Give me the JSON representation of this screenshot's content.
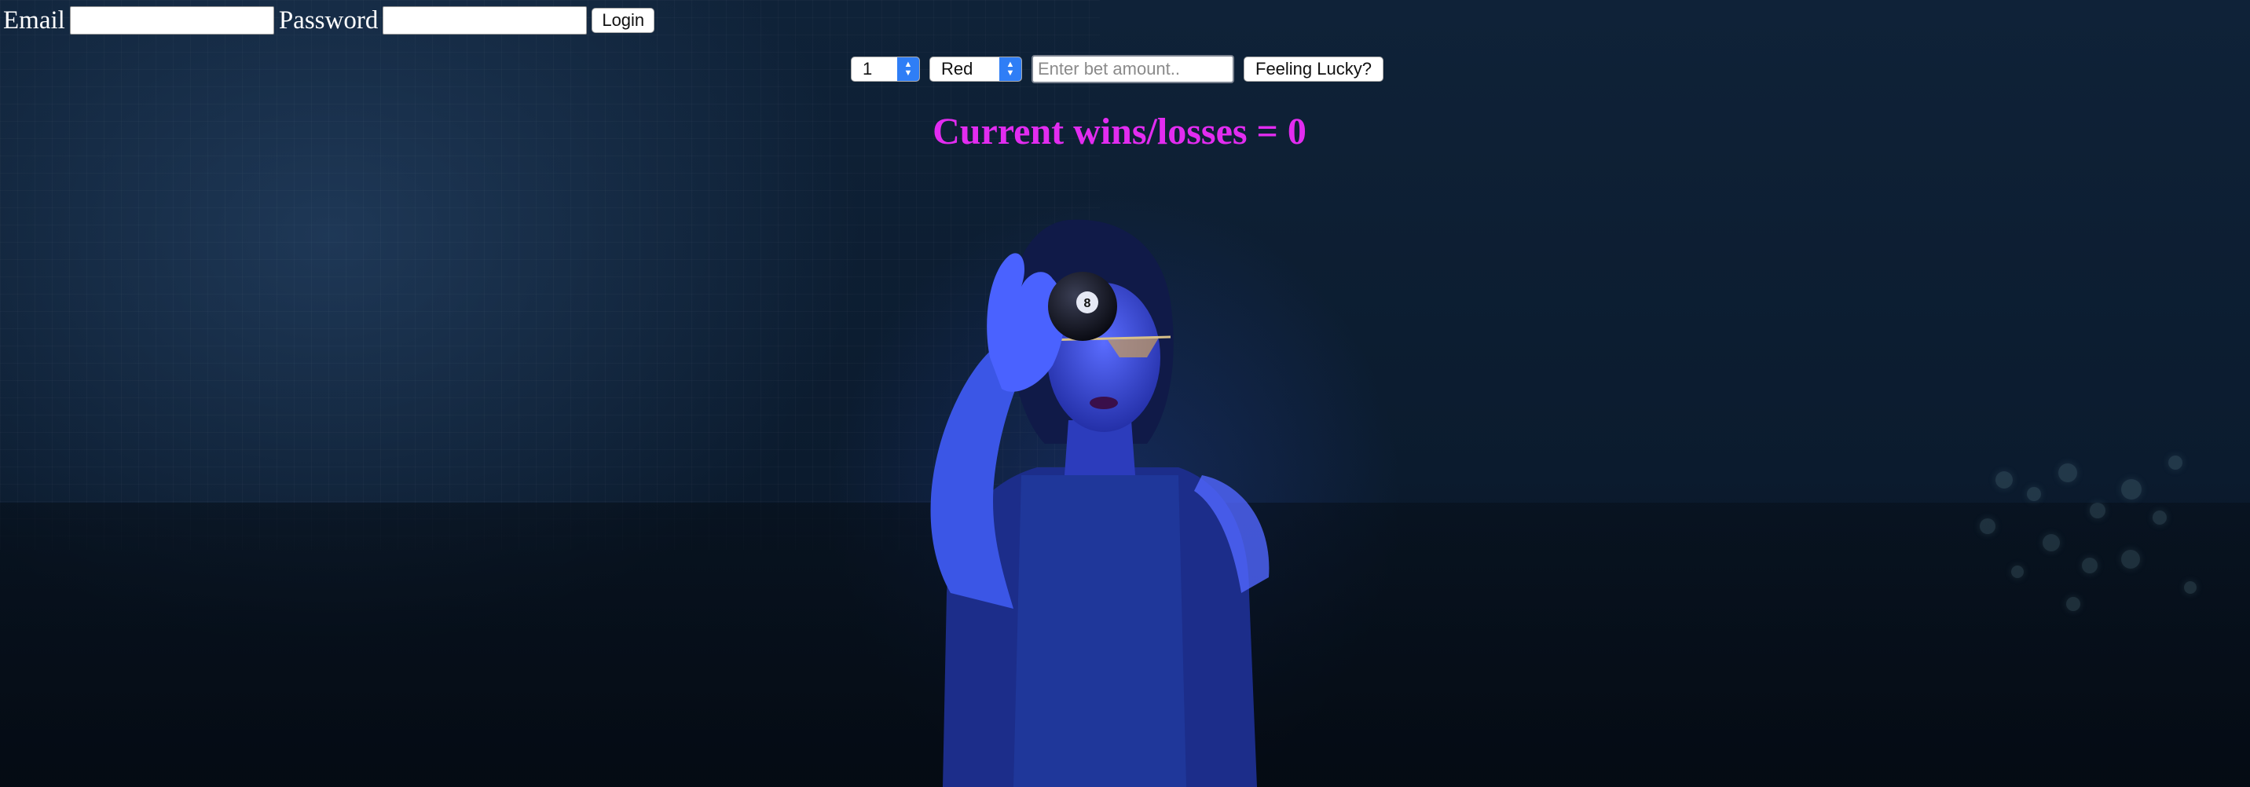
{
  "login": {
    "email_label": "Email",
    "email_value": "",
    "password_label": "Password",
    "password_value": "",
    "login_button": "Login"
  },
  "bet": {
    "number_selected": "1",
    "color_selected": "Red",
    "amount_placeholder": "Enter bet amount..",
    "lucky_button": "Feeling Lucky?"
  },
  "score": {
    "text": "Current wins/losses = 0"
  },
  "colors": {
    "score_text": "#e22cf0",
    "select_accent": "#2f7ef6",
    "background": "#0b1a2c"
  }
}
